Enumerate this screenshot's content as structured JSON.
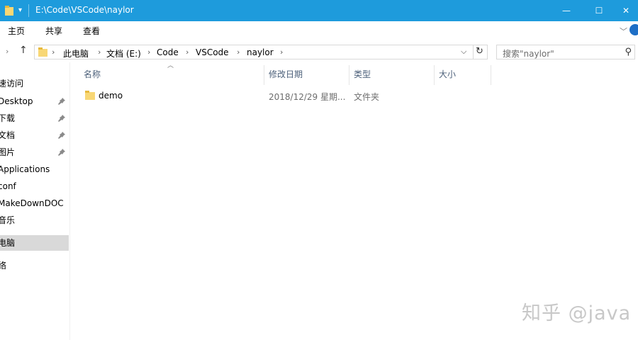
{
  "titlebar": {
    "title": "E:\\Code\\VSCode\\naylor",
    "minimize_glyph": "—",
    "maximize_glyph": "☐",
    "close_glyph": "✕"
  },
  "ribbon": {
    "tabs": [
      "主页",
      "共享",
      "查看"
    ]
  },
  "address": {
    "crumbs": [
      "此电脑",
      "文档 (E:)",
      "Code",
      "VSCode",
      "naylor"
    ],
    "separator": "›"
  },
  "search": {
    "placeholder": "搜索\"naylor\""
  },
  "nav": {
    "items": [
      {
        "label": "速访问",
        "pinned": false,
        "selected": false
      },
      {
        "label": "Desktop",
        "pinned": true,
        "selected": false
      },
      {
        "label": "下载",
        "pinned": true,
        "selected": false
      },
      {
        "label": "文档",
        "pinned": true,
        "selected": false
      },
      {
        "label": "图片",
        "pinned": true,
        "selected": false
      },
      {
        "label": "Applications",
        "pinned": false,
        "selected": false
      },
      {
        "label": "conf",
        "pinned": false,
        "selected": false
      },
      {
        "label": "MakeDownDOC",
        "pinned": false,
        "selected": false
      },
      {
        "label": "音乐",
        "pinned": false,
        "selected": false
      },
      {
        "label": "电脑",
        "pinned": false,
        "selected": true
      },
      {
        "label": "络",
        "pinned": false,
        "selected": false
      }
    ]
  },
  "columns": {
    "name": "名称",
    "date": "修改日期",
    "type": "类型",
    "size": "大小"
  },
  "files": [
    {
      "name": "demo",
      "date": "2018/12/29 星期...",
      "type": "文件夹",
      "size": ""
    }
  ],
  "watermark": "知乎 @java",
  "colors": {
    "titlebar": "#1e9bdc",
    "folder": "#f8d775",
    "selected": "#d9d9d9"
  }
}
